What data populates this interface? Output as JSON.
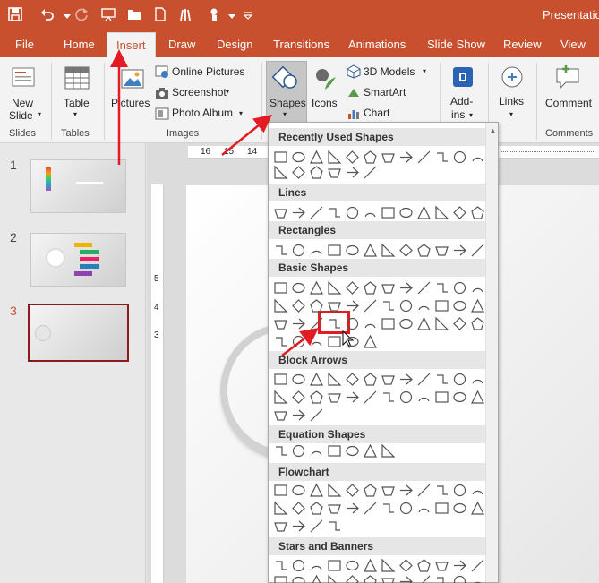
{
  "window": {
    "title": "Presentation"
  },
  "qat": [
    {
      "name": "save-icon"
    },
    {
      "name": "undo-icon"
    },
    {
      "name": "redo-icon"
    },
    {
      "name": "presenter-icon"
    },
    {
      "name": "open-folder-icon"
    },
    {
      "name": "new-file-icon"
    },
    {
      "name": "touch-mode-icon"
    },
    {
      "name": "customize-qat-icon"
    }
  ],
  "tabs": [
    {
      "label": "File"
    },
    {
      "label": "Home"
    },
    {
      "label": "Insert",
      "active": true
    },
    {
      "label": "Draw"
    },
    {
      "label": "Design"
    },
    {
      "label": "Transitions"
    },
    {
      "label": "Animations"
    },
    {
      "label": "Slide Show"
    },
    {
      "label": "Review"
    },
    {
      "label": "View"
    }
  ],
  "ribbon": {
    "new_slide": "New",
    "new_slide2": "Slide",
    "table": "Table",
    "pictures": "Pictures",
    "online_pictures": "Online Pictures",
    "screenshot": "Screenshot",
    "photo_album": "Photo Album",
    "shapes": "Shapes",
    "icons": "Icons",
    "models_3d": "3D Models",
    "smartart": "SmartArt",
    "chart": "Chart",
    "addins": "Add-",
    "addins2": "ins",
    "links": "Links",
    "comment": "Comment",
    "groups": {
      "slides": "Slides",
      "tables": "Tables",
      "images": "Images",
      "comments": "Comments"
    }
  },
  "slides": [
    {
      "number": "1",
      "selected": false
    },
    {
      "number": "2",
      "selected": false
    },
    {
      "number": "3",
      "selected": true
    }
  ],
  "ruler": {
    "labels": [
      "16",
      "15",
      "14"
    ]
  },
  "vruler": {
    "labels": [
      "5",
      "4",
      "3"
    ]
  },
  "gallery": {
    "sections": [
      {
        "title": "Recently Used Shapes"
      },
      {
        "title": "Lines"
      },
      {
        "title": "Rectangles"
      },
      {
        "title": "Basic Shapes"
      },
      {
        "title": "Block Arrows"
      },
      {
        "title": "Equation Shapes"
      },
      {
        "title": "Flowchart"
      },
      {
        "title": "Stars and Banners"
      }
    ],
    "highlighted_shape": "arc-shape"
  },
  "colors": {
    "accent": "#c8502f",
    "highlight": "#e31b23"
  }
}
